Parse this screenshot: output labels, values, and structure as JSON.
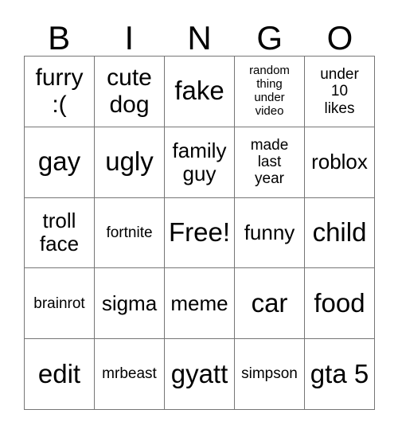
{
  "card": {
    "type": "bingo-card",
    "headers": [
      "B",
      "I",
      "N",
      "G",
      "O"
    ],
    "grid": [
      [
        {
          "text": "furry\n:(",
          "size": "fs-lg"
        },
        {
          "text": "cute\ndog",
          "size": "fs-lg"
        },
        {
          "text": "fake",
          "size": "fs-xl"
        },
        {
          "text": "random\nthing\nunder\nvideo",
          "size": "fs-xs"
        },
        {
          "text": "under\n10\nlikes",
          "size": "fs-sm"
        }
      ],
      [
        {
          "text": "gay",
          "size": "fs-xl"
        },
        {
          "text": "ugly",
          "size": "fs-xl"
        },
        {
          "text": "family\nguy",
          "size": "fs-md"
        },
        {
          "text": "made\nlast\nyear",
          "size": "fs-sm"
        },
        {
          "text": "roblox",
          "size": "fs-md"
        }
      ],
      [
        {
          "text": "troll\nface",
          "size": "fs-md"
        },
        {
          "text": "fortnite",
          "size": "fs-sm"
        },
        {
          "text": "Free!",
          "size": "fs-xl"
        },
        {
          "text": "funny",
          "size": "fs-md"
        },
        {
          "text": "child",
          "size": "fs-xl"
        }
      ],
      [
        {
          "text": "brainrot",
          "size": "fs-sm"
        },
        {
          "text": "sigma",
          "size": "fs-md"
        },
        {
          "text": "meme",
          "size": "fs-md"
        },
        {
          "text": "car",
          "size": "fs-xl"
        },
        {
          "text": "food",
          "size": "fs-xl"
        }
      ],
      [
        {
          "text": "edit",
          "size": "fs-xl"
        },
        {
          "text": "mrbeast",
          "size": "fs-sm"
        },
        {
          "text": "gyatt",
          "size": "fs-xl"
        },
        {
          "text": "simpson",
          "size": "fs-sm"
        },
        {
          "text": "gta 5",
          "size": "fs-xl"
        }
      ]
    ],
    "colors": {
      "background": "#ffffff",
      "text": "#000000",
      "border": "#767676"
    }
  }
}
